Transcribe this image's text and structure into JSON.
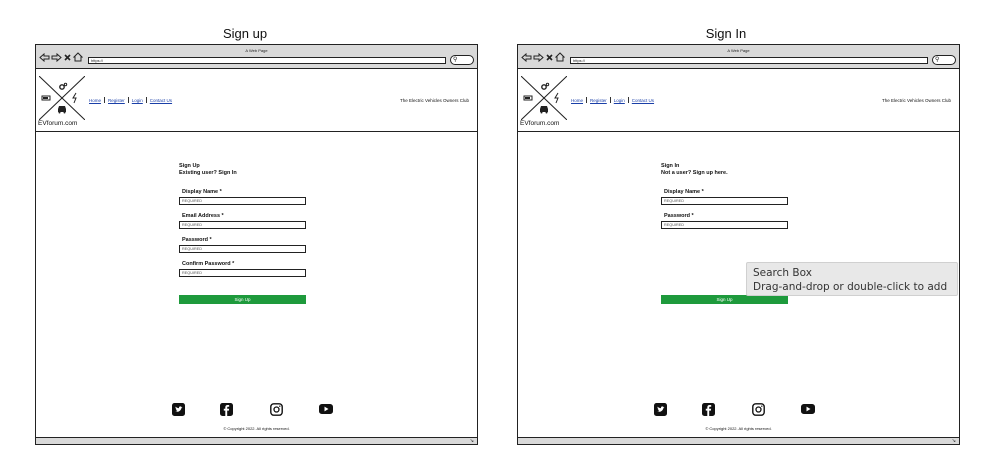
{
  "boards": [
    {
      "title": "Sign up",
      "browser": {
        "page_name": "A Web Page",
        "url": "https://"
      },
      "header": {
        "logo_text": "EVforum.com",
        "nav": [
          "Home",
          "Register",
          "Login",
          "Contact Us"
        ],
        "club_name": "The Electric Vehicles Owners Club"
      },
      "form": {
        "title": "Sign Up",
        "subtitle": "Existing user? Sign In",
        "fields": [
          {
            "label": "Display Name *",
            "placeholder": "REQUIRED"
          },
          {
            "label": "Email Address *",
            "placeholder": "REQUIRED"
          },
          {
            "label": "Password *",
            "placeholder": "REQUIRED"
          },
          {
            "label": "Confirm Password *",
            "placeholder": "REQUIRED"
          }
        ],
        "submit_label": "Sign Up"
      },
      "footer": {
        "social_icons": [
          "twitter-icon",
          "facebook-icon",
          "instagram-icon",
          "youtube-icon"
        ],
        "copyright": "Copyright 2022. All rights reserved."
      }
    },
    {
      "title": "Sign In",
      "browser": {
        "page_name": "A Web Page",
        "url": "https://"
      },
      "header": {
        "logo_text": "EVforum.com",
        "nav": [
          "Home",
          "Register",
          "Login",
          "Contact Us"
        ],
        "club_name": "The Electric Vehicles Owners Club"
      },
      "form": {
        "title": "Sign In",
        "subtitle": "Not a user? Sign up here.",
        "fields": [
          {
            "label": "Display Name *",
            "placeholder": "REQUIRED"
          },
          {
            "label": "Password *",
            "placeholder": "REQUIRED"
          }
        ],
        "submit_label": "Sign Up"
      },
      "footer": {
        "social_icons": [
          "twitter-icon",
          "facebook-icon",
          "instagram-icon",
          "youtube-icon"
        ],
        "copyright": "Copyright 2022. All rights reserved."
      }
    }
  ],
  "tooltip": {
    "title": "Search Box",
    "hint": "Drag-and-drop or double-click to add"
  },
  "colors": {
    "submit_green": "#1e9a3c",
    "link_blue": "#1a3fa8",
    "chrome_gray": "#d9d9d9"
  }
}
